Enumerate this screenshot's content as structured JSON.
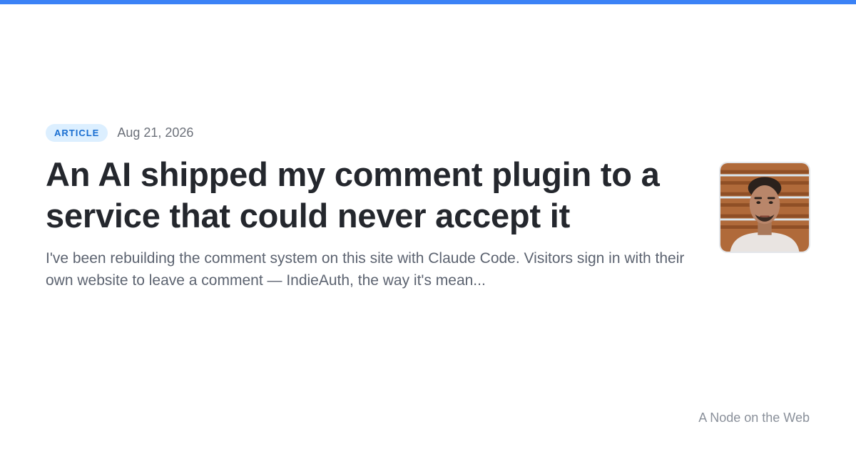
{
  "colors": {
    "accent": "#3b82f6",
    "badge_bg": "#dcefff",
    "badge_text": "#1a6fd1"
  },
  "post": {
    "type_label": "ARTICLE",
    "date": "Aug 21, 2026",
    "title": "An AI shipped my comment plugin to a service that could never accept it",
    "excerpt": "I've been rebuilding the comment system on this site with Claude Code. Visitors sign in with their own website to leave a comment — IndieAuth, the way it's mean..."
  },
  "author": {
    "avatar_icon": "author-photo"
  },
  "site": {
    "name": "A Node on the Web"
  }
}
